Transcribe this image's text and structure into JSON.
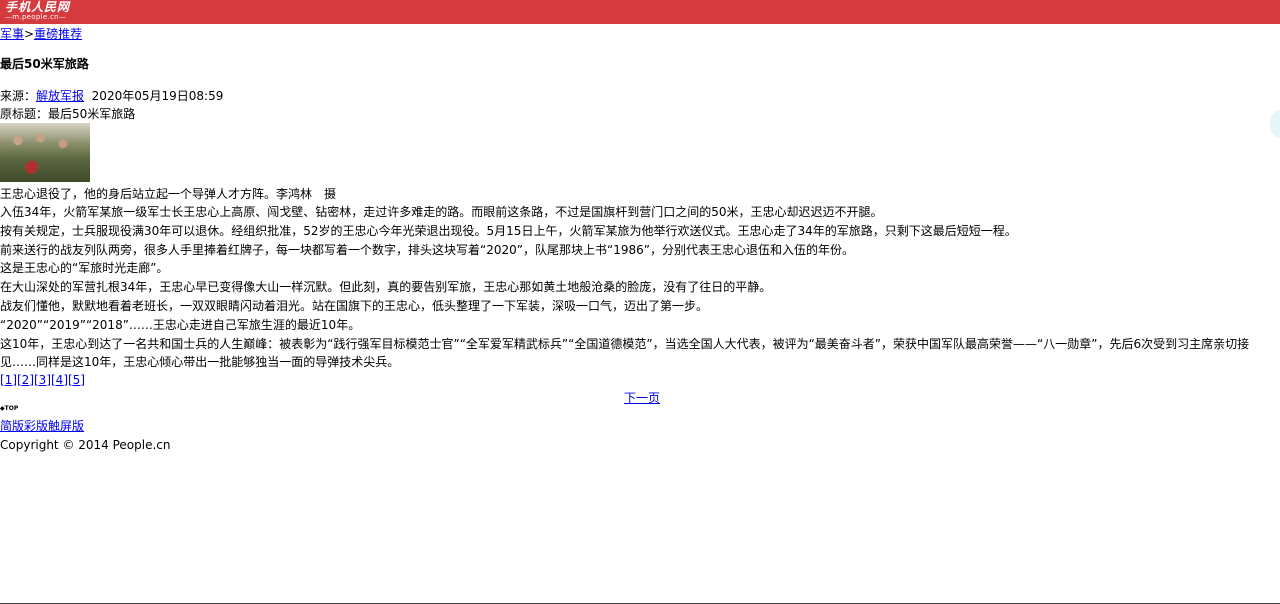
{
  "header": {
    "logo_main": "手机人民网",
    "logo_sub": "—m.people.cn—"
  },
  "breadcrumb": {
    "section": "军事",
    "separator": ">",
    "subsection": "重磅推荐"
  },
  "article": {
    "title": "最后50米军旅路",
    "source_label": "来源：",
    "source_name": "解放军报",
    "datetime": "2020年05月19日08:59",
    "original_title": "原标题：最后50米军旅路",
    "photo_caption": "王忠心退役了，他的身后站立起一个导弹人才方阵。李鸿林　摄",
    "paragraphs": [
      "入伍34年，火箭军某旅一级军士长王忠心上高原、闯戈壁、钻密林，走过许多难走的路。而眼前这条路，不过是国旗杆到营门口之间的50米，王忠心却迟迟迈不开腿。",
      "按有关规定，士兵服现役满30年可以退休。经组织批准，52岁的王忠心今年光荣退出现役。5月15日上午，火箭军某旅为他举行欢送仪式。王忠心走了34年的军旅路，只剩下这最后短短一程。",
      "前来送行的战友列队两旁，很多人手里捧着红牌子，每一块都写着一个数字，排头这块写着“2020”，队尾那块上书“1986”，分别代表王忠心退伍和入伍的年份。",
      "这是王忠心的“军旅时光走廊”。",
      "在大山深处的军营扎根34年，王忠心早已变得像大山一样沉默。但此刻，真的要告别军旅，王忠心那如黄土地般沧桑的脸庞，没有了往日的平静。",
      "战友们懂他，默默地看着老班长，一双双眼睛闪动着泪光。站在国旗下的王忠心，低头整理了一下军装，深吸一口气，迈出了第一步。",
      "“2020”“2019”“2018”……王忠心走进自己军旅生涯的最近10年。",
      "这10年，王忠心到达了一名共和国士兵的人生巅峰：被表彰为“践行强军目标模范士官”“全军爱军精武标兵”“全国道德模范”，当选全国人大代表，被评为“最美奋斗者”，荣获中国军队最高荣誉——“八一勋章”，先后6次受到习主席亲切接见……同样是这10年，王忠心倾心带出一批能够独当一面的导弹技术尖兵。"
    ]
  },
  "pagination": {
    "pages": [
      "[1]",
      "[2]",
      "[3]",
      "[4]",
      "[5]"
    ],
    "next_label": "下一页"
  },
  "footer": {
    "top_label": "TOP",
    "versions": [
      "简版",
      "彩版",
      "触屏版"
    ],
    "copyright": "Copyright © 2014 People.cn"
  },
  "colors": {
    "header_bg": "#d53a3f",
    "link": "#0000ee"
  }
}
